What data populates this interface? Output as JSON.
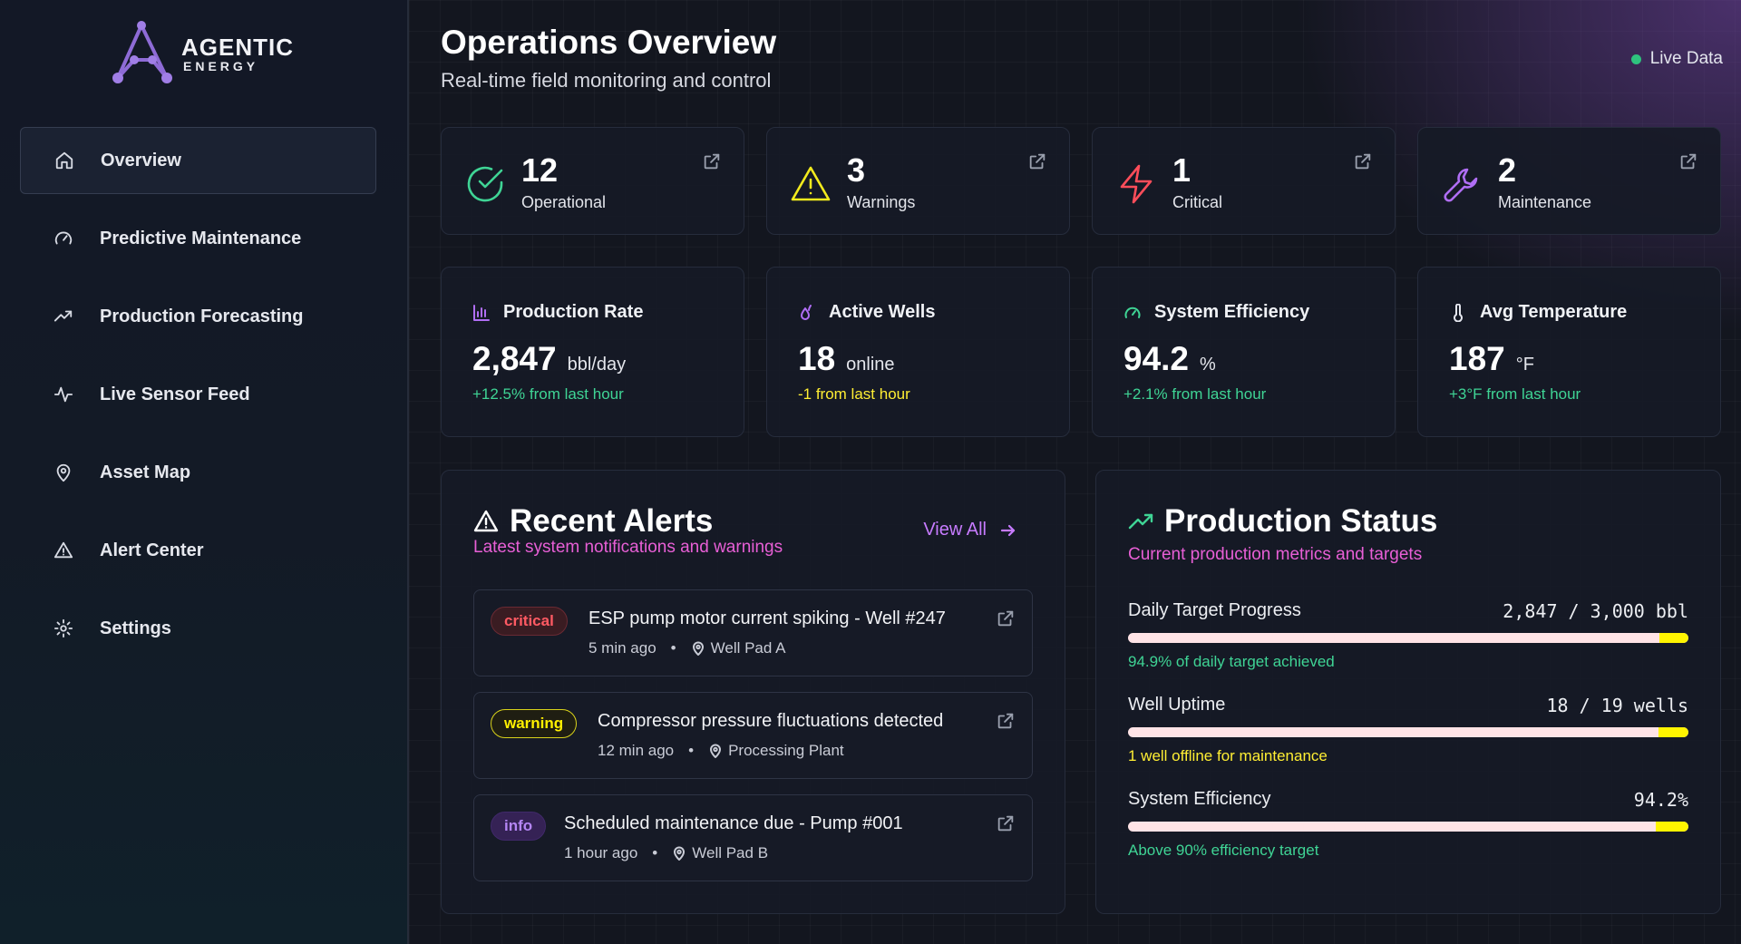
{
  "brand": {
    "title": "AGENTIC",
    "subtitle": "ENERGY"
  },
  "sidebar": {
    "items": [
      {
        "label": "Overview",
        "icon": "home-icon"
      },
      {
        "label": "Predictive Maintenance",
        "icon": "gauge-icon"
      },
      {
        "label": "Production Forecasting",
        "icon": "trending-up-icon"
      },
      {
        "label": "Live Sensor Feed",
        "icon": "activity-icon"
      },
      {
        "label": "Asset Map",
        "icon": "map-pin-icon"
      },
      {
        "label": "Alert Center",
        "icon": "alert-triangle-icon"
      },
      {
        "label": "Settings",
        "icon": "gear-icon"
      }
    ]
  },
  "header": {
    "title": "Operations Overview",
    "subtitle": "Real-time field monitoring and control",
    "live_label": "Live Data"
  },
  "status_cards": [
    {
      "value": "12",
      "label": "Operational",
      "icon": "check-circle-icon",
      "color": "#3fd495"
    },
    {
      "value": "3",
      "label": "Warnings",
      "icon": "warning-triangle-icon",
      "color": "#f2ea1d"
    },
    {
      "value": "1",
      "label": "Critical",
      "icon": "lightning-icon",
      "color": "#ff4d5a"
    },
    {
      "value": "2",
      "label": "Maintenance",
      "icon": "wrench-icon",
      "color": "#b06ef5"
    }
  ],
  "metrics": [
    {
      "title": "Production Rate",
      "value": "2,847",
      "unit": "bbl/day",
      "change": "+12.5% from last hour",
      "icon": "bar-chart-icon"
    },
    {
      "title": "Active Wells",
      "value": "18",
      "unit": "online",
      "change": "-1 from last hour",
      "icon": "droplets-icon"
    },
    {
      "title": "System Efficiency",
      "value": "94.2",
      "unit": "%",
      "change": "+2.1% from last hour",
      "icon": "gauge-icon"
    },
    {
      "title": "Avg Temperature",
      "value": "187",
      "unit": "°F",
      "change": "+3°F from last hour",
      "icon": "thermometer-icon"
    }
  ],
  "alerts": {
    "title": "Recent Alerts",
    "subtitle": "Latest system notifications and warnings",
    "view_all": "View All",
    "items": [
      {
        "severity": "critical",
        "text": "ESP pump motor current spiking - Well #247",
        "time": "5 min ago",
        "location": "Well Pad A"
      },
      {
        "severity": "warning",
        "text": "Compressor pressure fluctuations detected",
        "time": "12 min ago",
        "location": "Processing Plant"
      },
      {
        "severity": "info",
        "text": "Scheduled maintenance due - Pump #001",
        "time": "1 hour ago",
        "location": "Well Pad B"
      }
    ]
  },
  "production": {
    "title": "Production Status",
    "subtitle": "Current production metrics and targets",
    "rows": [
      {
        "label": "Daily Target Progress",
        "value": "2,847 / 3,000 bbl",
        "note": "94.9% of daily target achieved",
        "progress": 0.949
      },
      {
        "label": "Well Uptime",
        "value": "18 / 19 wells",
        "note": "1 well offline for maintenance",
        "progress": 0.947
      },
      {
        "label": "System Efficiency",
        "value": "94.2%",
        "note": "Above 90% efficiency target",
        "progress": 0.942
      }
    ]
  },
  "dot_separator": "•"
}
